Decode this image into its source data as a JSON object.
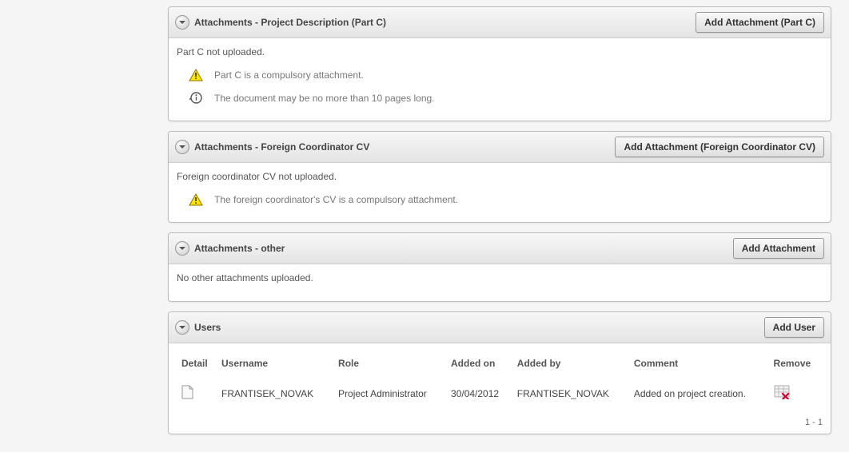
{
  "panels": {
    "partc": {
      "title": "Attachments - Project Description (Part C)",
      "button": "Add Attachment (Part C)",
      "status": "Part C not uploaded.",
      "warning": "Part C is a compulsory attachment.",
      "info": "The document may be no more than 10 pages long."
    },
    "foreign": {
      "title": "Attachments - Foreign Coordinator CV",
      "button": "Add Attachment (Foreign Coordinator CV)",
      "status": "Foreign coordinator CV not uploaded.",
      "warning": "The foreign coordinator's CV is a compulsory attachment."
    },
    "other": {
      "title": "Attachments - other",
      "button": "Add Attachment",
      "status": "No other attachments uploaded."
    },
    "users": {
      "title": "Users",
      "button": "Add User",
      "headers": {
        "detail": "Detail",
        "username": "Username",
        "role": "Role",
        "added_on": "Added on",
        "added_by": "Added by",
        "comment": "Comment",
        "remove": "Remove"
      },
      "rows": {
        "0": {
          "username": "FRANTISEK_NOVAK",
          "role": "Project Administrator",
          "added_on": "30/04/2012",
          "added_by": "FRANTISEK_NOVAK",
          "comment": "Added on project creation."
        }
      },
      "pagination": "1 - 1"
    }
  }
}
